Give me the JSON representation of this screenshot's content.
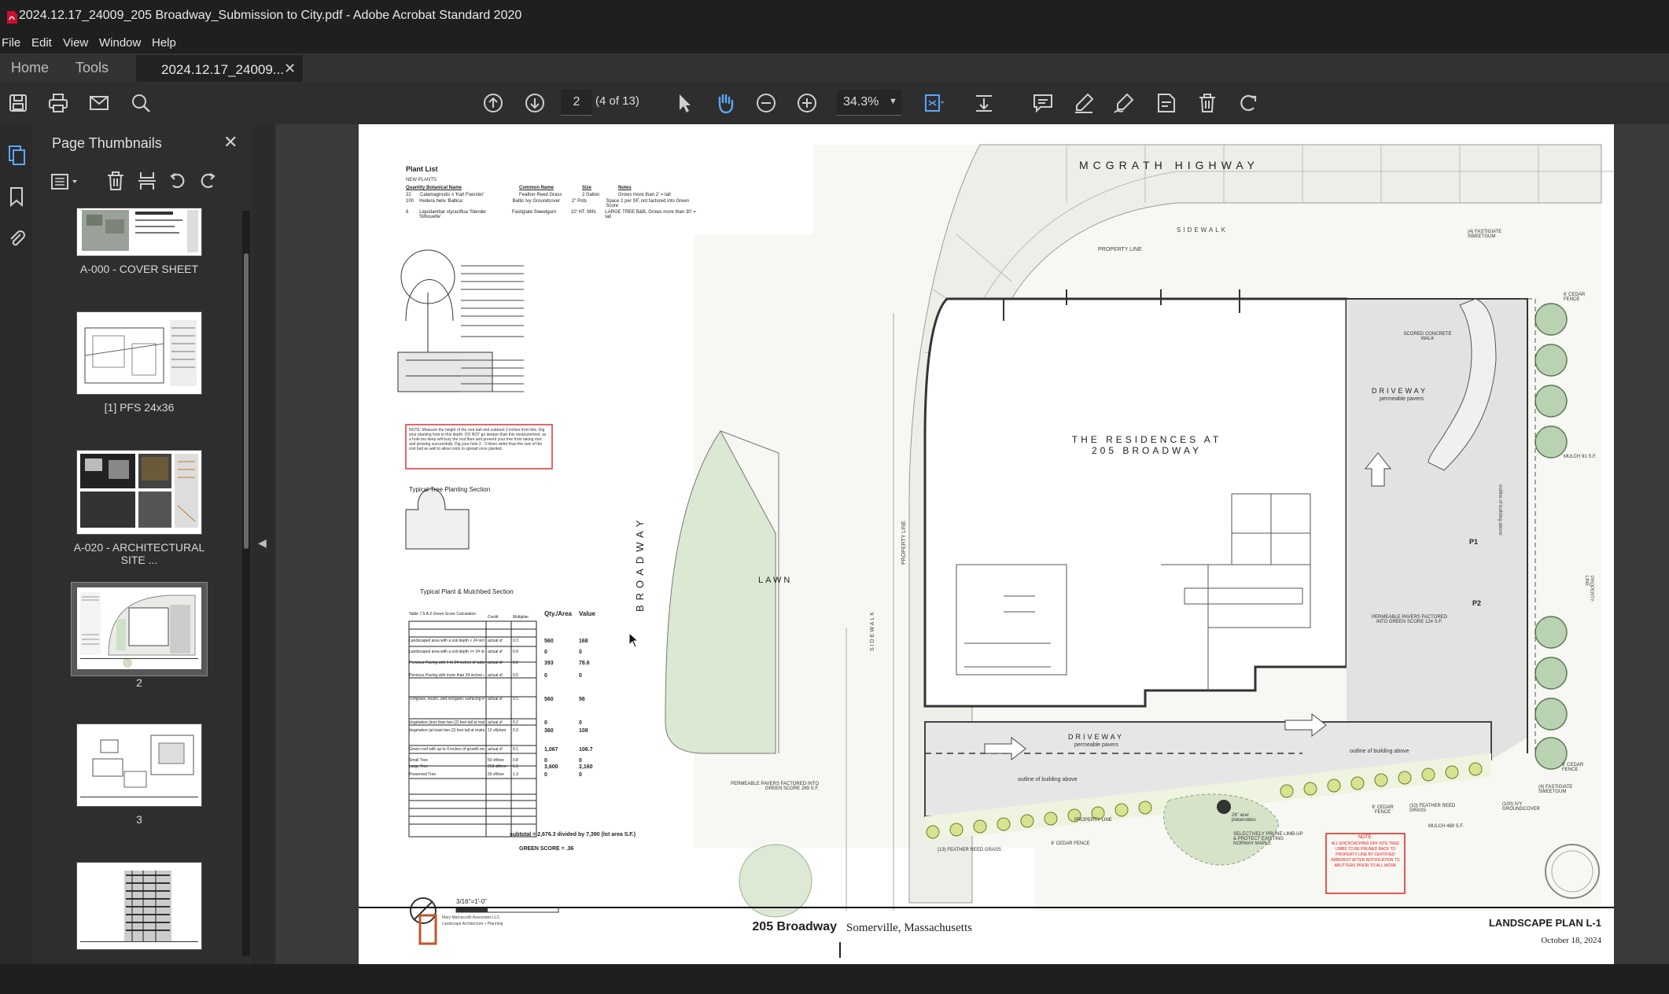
{
  "window": {
    "title": "2024.12.17_24009_205 Broadway_Submission to City.pdf - Adobe Acrobat Standard 2020"
  },
  "menu": [
    "File",
    "Edit",
    "View",
    "Window",
    "Help"
  ],
  "tabs": {
    "home": "Home",
    "tools": "Tools",
    "document": "2024.12.17_24009..."
  },
  "toolbar": {
    "page_number": "2",
    "page_of": "(4 of 13)",
    "zoom": "34.3%"
  },
  "panel": {
    "title": "Page Thumbnails",
    "thumbnails": [
      {
        "label": "A-000 - COVER SHEET"
      },
      {
        "label": "[1] PFS 24x36"
      },
      {
        "label": "A-020 - ARCHITECTURAL SITE ..."
      },
      {
        "label": "2"
      },
      {
        "label": "3"
      },
      {
        "label": ""
      }
    ]
  },
  "drawing": {
    "plant_list_title": "Plant List",
    "new_plants": "NEW PLANTS",
    "plant_headers": [
      "Quantity Botanical Name",
      "Common Name",
      "Size",
      "Notes"
    ],
    "plants": [
      [
        "22",
        "Calamagrostis x 'Karl Foerster'",
        "Feather Reed Grass",
        "2 Gallon",
        "Grows more than 2' = tall"
      ],
      [
        "100",
        "Hedera helix 'Baltica'",
        "Baltic Ivy Groundcover",
        "2\" Pots",
        "Space 1 per SF, not factored into Green Score"
      ],
      [
        "8",
        "Liquidambar styraciflua 'Slender Silhouette'",
        "Fastigiate Sweetgum",
        "10' HT. MIN.",
        "LARGE TREE B&B, Grows more than 30' = tall"
      ]
    ],
    "note_box": "NOTE: Measure the height of the root ball and subtract 2 inches from this. Dig your planting hole to this depth. DO NOT go deeper than this measurement, as a hole too deep will bury the root flare and prevent your tree from taking root and growing successfully. Dig your hole 2 - 3 times wider than the size of the root ball as well to allow roots to spread once planted.",
    "tree_section_label": "Typical Tree Planting Section",
    "mulch_section_label": "Typical Plant & Mulchbed Section",
    "green_score": {
      "title": "Table 7.5.A.2 Green Score Calculation",
      "headers": [
        "Credit",
        "Multiplier",
        "Qty./Area",
        "Value"
      ],
      "rows": [
        [
          "Landscaped area with a soil depth < 24 inches",
          "actual sf",
          "0.3",
          "560",
          "168"
        ],
        [
          "Landscaped area with a soil depth >= 24 inches",
          "actual sf",
          "0.6",
          "0",
          "0"
        ],
        [
          "Pervious Paving with 6 to 24 inches of subsurface soil or gravel",
          "actual sf",
          "0.2",
          "393",
          "78.6"
        ],
        [
          "Pervious Paving with more than 24 inches of subsurface soil or gravel",
          "actual sf",
          "0.5",
          "0",
          "0"
        ],
        [
          "Turfgrass, mulch, and inorganic surfacing materials",
          "actual sf",
          "0.1",
          "560",
          "56"
        ],
        [
          "Vegetation (less than two (2) feet tall at maturity)",
          "actual sf",
          "0.2",
          "0",
          "0"
        ],
        [
          "Vegetation (at least two (2) feet tall at maturity)",
          "12 sf/plant",
          "0.3",
          "360",
          "108"
        ],
        [
          "Green roof with up to 4 inches of growth medium",
          "actual sf",
          "0.1",
          "1,067",
          "106.7"
        ],
        [
          "Small Tree",
          "50 sf/tree",
          "0.8",
          "0",
          "0"
        ],
        [
          "Large Tree",
          "250 sf/tree",
          "1.1",
          "3,600",
          "2,160"
        ],
        [
          "Preserved Tree",
          "50 sf/tree",
          "1.3",
          "0",
          "0"
        ]
      ],
      "subtotal": "subtotal = 2,676.3 divided by 7,390 (lot area S.F.)",
      "green_score": "GREEN SCORE = .36"
    },
    "scale": "3/16\"=1'-0\"",
    "labels": {
      "mcgrath": "MCGRATH HIGHWAY",
      "sidewalk_top": "SIDEWALK",
      "property_line": "PROPERTY LINE",
      "broadway": "BROADWAY",
      "lawn": "LAWN",
      "sidewalk_left": "SIDEWALK",
      "property_line_left": "PROPERTY LINE",
      "building1": "THE RESIDENCES AT",
      "building2": "205 BROADWAY",
      "driveway_top": "DRIVEWAY",
      "permeable_pavers_top": "permeable pavers",
      "driveway_bottom": "DRIVEWAY",
      "permeable_pavers_bottom": "permeable pavers",
      "fastigiate_top": "(4) FASTIGIATE SWEETGUM",
      "cedar_top": "6' CEDAR FENCE",
      "scored": "SCORED CONCRETE WALK",
      "mulch91": "MULCH 91 S.F.",
      "p1": "P1",
      "p2": "P2",
      "permeable_right": "PERMEABLE PAVERS FACTORED INTO GREEN SCORE 124 S.F.",
      "outline_building": "outline of building above",
      "outline_building2": "outline of building above",
      "permeable_left": "PERMEABLE PAVERS FACTORED INTO GREEN SCORE 269 S.F.",
      "property_line_bottom": "PROPERTY LINE",
      "feather": "(13) FEATHER REED GRASS",
      "cedar_b1": "6' CEDAR FENCE",
      "acer": "26\" acer platanoides",
      "prune": "SELECTIVELY PRUNE LIMB-UP & PROTECT EXISTING NORWAY MAPLE",
      "cedar_b2": "6' CEDAR FENCE",
      "feather10": "(10) FEATHER REED GRASS",
      "mulch469": "MULCH 469 S.F.",
      "ivy": "(100) IVY GROUNDCOVER",
      "fastigiate_bottom": "(4) FASTIGIATE SWEETGUM",
      "cedar_right_b": "6' CEDAR FENCE",
      "note_red_title": "NOTE:",
      "note_red": "ALL ENCROACHING OFF-SITE TREE LIMBS TO BE PRUNED BACK TO PROPERTY LINE BY CERTIFIED ARBORIST AFTER NOTIFICATION TO ABUTTERS PRIOR TO ALL WORK",
      "property_line_right": "PROPERTY LINE",
      "outline_right": "outline of building above"
    },
    "firm": "Mary Marcaccelli Associates LLC",
    "firm_sub": "Landscape Architecture + Planning",
    "footer_left": "205 Broadway",
    "footer_city": "Somerville, Massachusetts",
    "sheet_title": "LANDSCAPE PLAN L-1",
    "sheet_date": "October 18, 2024"
  }
}
